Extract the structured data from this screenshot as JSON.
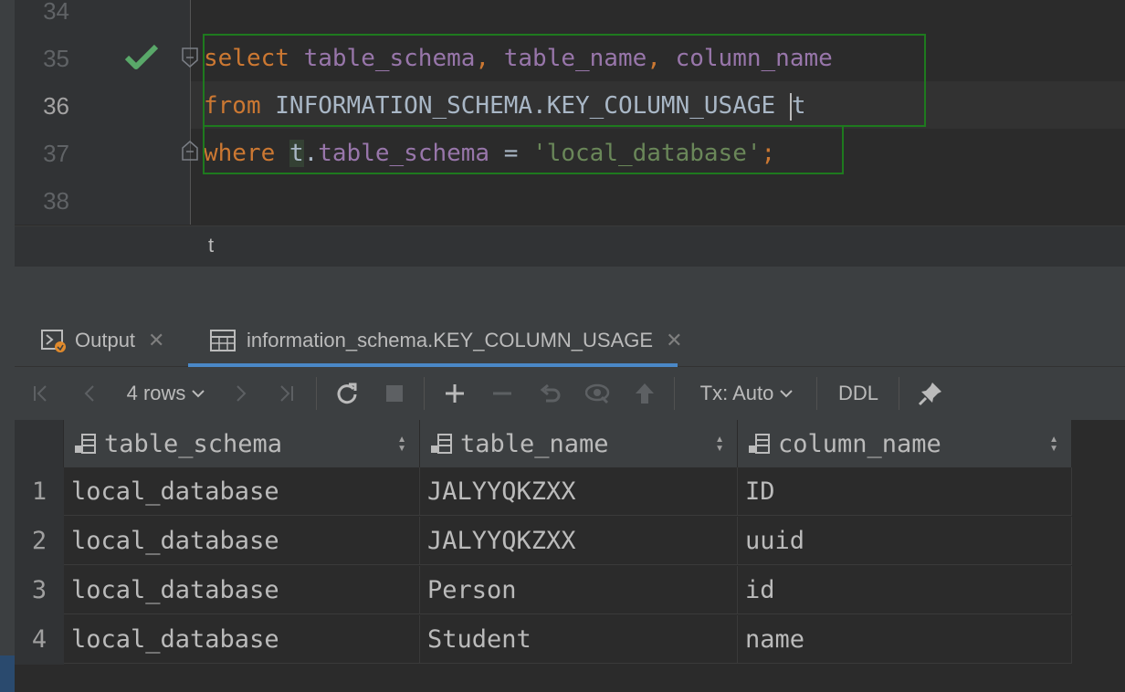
{
  "editor": {
    "lines": [
      {
        "num": "34"
      },
      {
        "num": "35"
      },
      {
        "num": "36"
      },
      {
        "num": "37"
      },
      {
        "num": "38"
      }
    ],
    "code": {
      "l35": {
        "kw": "select",
        "c1": "table_schema",
        "comma1": ",",
        "c2": "table_name",
        "comma2": ",",
        "c3": "column_name"
      },
      "l36": {
        "kw": "from",
        "obj": "INFORMATION_SCHEMA.KEY_COLUMN_USAGE",
        "alias": "t"
      },
      "l37": {
        "kw": "where",
        "alias": "t",
        "dot": ".",
        "col": "table_schema",
        "op": "=",
        "str": "'local_database'",
        "semi": ";"
      }
    },
    "breadcrumb": "t"
  },
  "tabs": [
    {
      "label": "Output",
      "icon": "console-run-icon"
    },
    {
      "label": "information_schema.KEY_COLUMN_USAGE",
      "icon": "table-grid-icon",
      "active": true
    }
  ],
  "toolbar": {
    "rows_label": "4 rows",
    "tx_label": "Tx: Auto",
    "ddl_label": "DDL"
  },
  "grid": {
    "columns": [
      "table_schema",
      "table_name",
      "column_name"
    ],
    "rows": [
      {
        "n": "1",
        "cells": [
          "local_database",
          "JALYYQKZXX",
          "ID"
        ]
      },
      {
        "n": "2",
        "cells": [
          "local_database",
          "JALYYQKZXX",
          "uuid"
        ]
      },
      {
        "n": "3",
        "cells": [
          "local_database",
          "Person",
          "id"
        ]
      },
      {
        "n": "4",
        "cells": [
          "local_database",
          "Student",
          "name"
        ]
      }
    ]
  },
  "colors": {
    "keyword": "#cc7832",
    "identifier": "#9876aa",
    "string": "#6a8759",
    "check": "#59a869",
    "accent": "#4a88c7"
  }
}
